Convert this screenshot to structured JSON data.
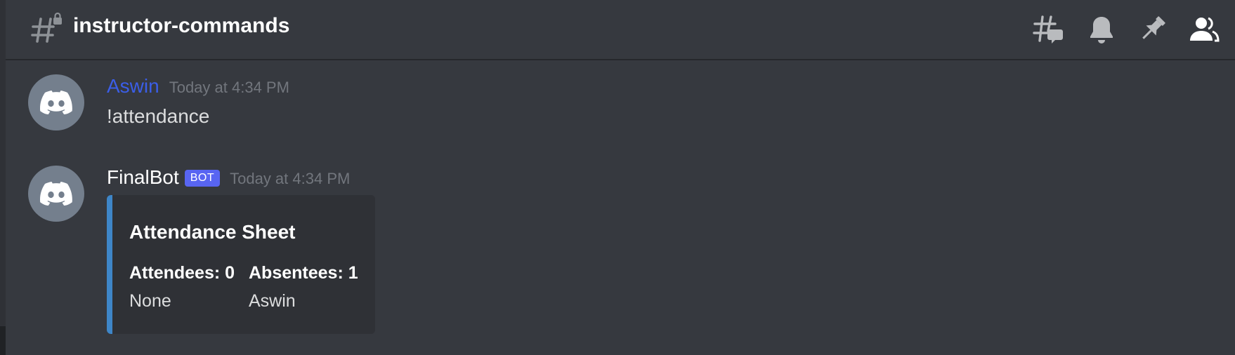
{
  "header": {
    "channel_name": "instructor-commands",
    "channel_icon": "locked-text-channel-icon",
    "toolbar_icons": [
      "threads-icon",
      "bell-icon",
      "pin-icon",
      "member-list-icon"
    ]
  },
  "messages": [
    {
      "author": "Aswin",
      "author_color": "#3b5ee8",
      "timestamp": "Today at 4:34 PM",
      "content": "!attendance",
      "avatar_icon": "discord-logo-icon"
    },
    {
      "author": "FinalBot",
      "author_color": "#ffffff",
      "badge": "BOT",
      "timestamp": "Today at 4:34 PM",
      "avatar_icon": "discord-logo-icon",
      "embed": {
        "accent_color": "#3e86c8",
        "title": "Attendance Sheet",
        "fields": [
          {
            "name": "Attendees: 0",
            "value": "None"
          },
          {
            "name": "Absentees: 1",
            "value": "Aswin"
          }
        ]
      }
    }
  ],
  "colors": {
    "background": "#36393f",
    "embed_background": "#2f3136",
    "badge": "#5865f2"
  }
}
